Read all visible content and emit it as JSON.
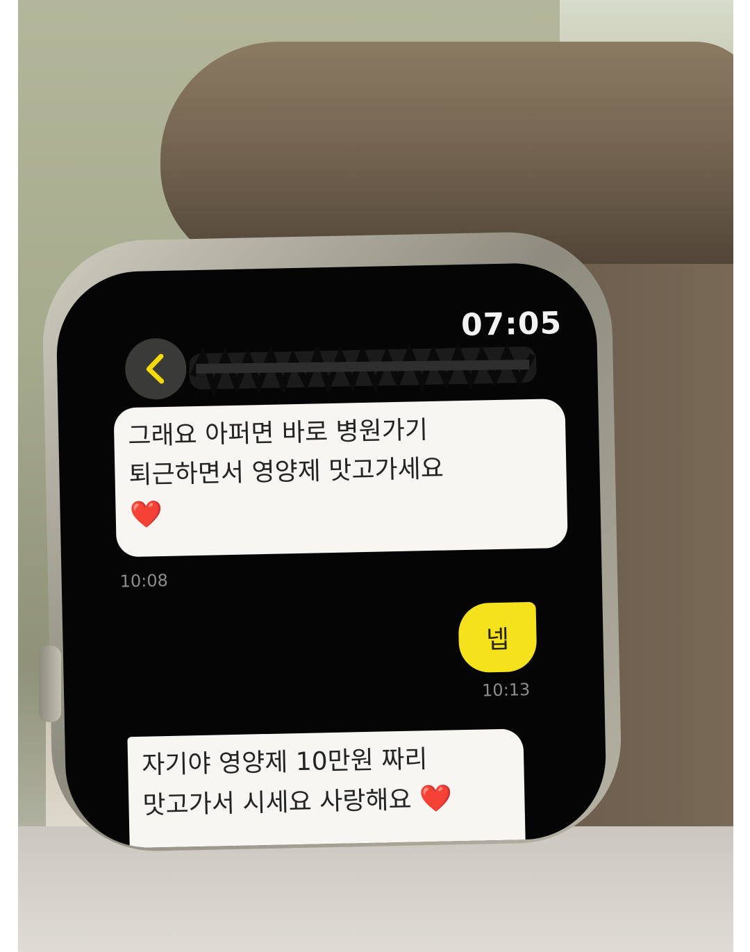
{
  "watch": {
    "clock": "07:05",
    "header": {
      "contact_name_redacted": ""
    },
    "messages": [
      {
        "direction": "received",
        "lines": [
          "그래요 아퍼면 바로 병원가기",
          "퇴근하면서 영양제 맛고가세요"
        ],
        "emoji": "❤️",
        "time": "10:08"
      },
      {
        "direction": "sent",
        "text": "넵",
        "time": "10:13"
      },
      {
        "direction": "received",
        "lines": [
          "자기야 영양제 10만원 짜리",
          "맛고가서 시세요 사랑해요"
        ],
        "emoji": "❤️"
      }
    ]
  },
  "colors": {
    "screen_bg": "#050505",
    "received_bubble": "#f7f6f2",
    "sent_bubble": "#f6e21c",
    "back_chevron": "#f5d90a",
    "timestamp": "#8d8d8d",
    "heart": "#d3141b"
  },
  "icons": {
    "back": "chevron-left-icon",
    "emoji": "red-heart-icon"
  }
}
